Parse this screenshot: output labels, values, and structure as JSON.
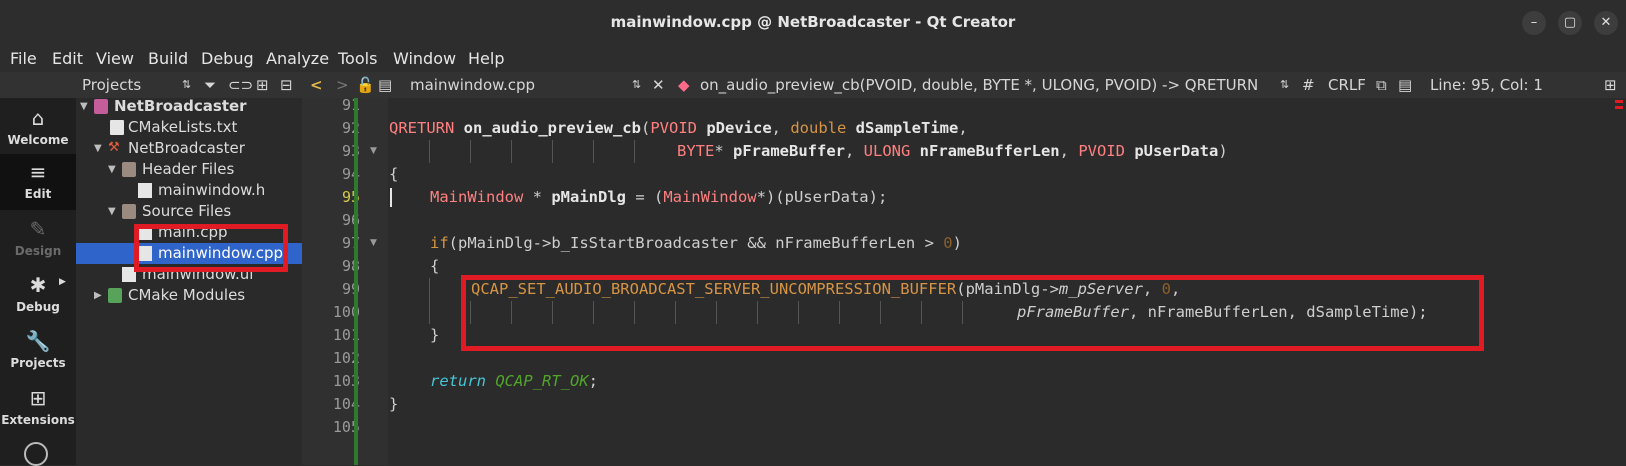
{
  "window": {
    "title": "mainwindow.cpp @ NetBroadcaster - Qt Creator",
    "minimize": "–",
    "maximize": "▢",
    "close": "✕"
  },
  "menu": [
    "File",
    "Edit",
    "View",
    "Build",
    "Debug",
    "Analyze",
    "Tools",
    "Window",
    "Help"
  ],
  "tree_toolbar": {
    "title": "Projects"
  },
  "editor_toolbar": {
    "filename": "mainwindow.cpp",
    "symbol": "on_audio_preview_cb(PVOID, double, BYTE *, ULONG, PVOID) -> QRETURN",
    "hash": "#",
    "encoding": "CRLF",
    "position": "Line: 95, Col: 1"
  },
  "modes": [
    {
      "label": "Welcome",
      "icon": "home-icon"
    },
    {
      "label": "Edit",
      "icon": "edit-icon"
    },
    {
      "label": "Design",
      "icon": "design-icon"
    },
    {
      "label": "Debug",
      "icon": "debug-icon"
    },
    {
      "label": "Projects",
      "icon": "projects-icon"
    },
    {
      "label": "Extensions",
      "icon": "extensions-icon"
    }
  ],
  "tree": [
    {
      "label": "NetBroadcaster",
      "level": 0,
      "expanded": true,
      "bold": true,
      "icon": "project-icon"
    },
    {
      "label": "CMakeLists.txt",
      "level": 1,
      "icon": "cmake-file-icon"
    },
    {
      "label": "NetBroadcaster",
      "level": 1,
      "expanded": true,
      "icon": "hammer-icon"
    },
    {
      "label": "Header Files",
      "level": 2,
      "expanded": true,
      "icon": "folder-icon"
    },
    {
      "label": "mainwindow.h",
      "level": 3,
      "icon": "header-file-icon"
    },
    {
      "label": "Source Files",
      "level": 2,
      "expanded": true,
      "icon": "folder-icon"
    },
    {
      "label": "main.cpp",
      "level": 3,
      "icon": "cpp-file-icon"
    },
    {
      "label": "mainwindow.cpp",
      "level": 3,
      "selected": true,
      "icon": "cpp-file-icon"
    },
    {
      "label": "mainwindow.ui",
      "level": 2,
      "icon": "ui-file-icon"
    },
    {
      "label": "CMake Modules",
      "level": 1,
      "collapsed": true,
      "icon": "cmake-folder-icon"
    }
  ],
  "line_numbers": [
    "91",
    "92",
    "93",
    "94",
    "95",
    "96",
    "97",
    "98",
    "99",
    "100",
    "101",
    "102",
    "103",
    "104",
    "105"
  ],
  "code": {
    "l92": {
      "t1": "QRETURN",
      "t2": "on_audio_preview_cb",
      "t3": "(",
      "t4": "PVOID",
      "t5": " pDevice",
      "t6": ", ",
      "t7": "double",
      "t8": " dSampleTime",
      "t9": ","
    },
    "l93": {
      "t1": "BYTE",
      "t2": "* ",
      "t3": "pFrameBuffer",
      "t4": ", ",
      "t5": "ULONG",
      "t6": " nFrameBufferLen",
      "t7": ", ",
      "t8": "PVOID",
      "t9": " pUserData",
      "t10": ")"
    },
    "l94": "{",
    "l95": {
      "t1": "MainWindow",
      "t2": " * ",
      "t3": "pMainDlg",
      "t4": " = (",
      "t5": "MainWindow",
      "t6": "*)(pUserData);"
    },
    "l97": {
      "t1": "if",
      "t2": "(pMainDlg->b_IsStartBroadcaster && nFrameBufferLen > ",
      "t3": "0",
      "t4": ")"
    },
    "l98": "{",
    "l99": {
      "t1": "QCAP_SET_AUDIO_BROADCAST_SERVER_UNCOMPRESSION_BUFFER",
      "t2": "(pMainDlg->",
      "t3": "m_pServer",
      "t4": ", ",
      "t5": "0",
      "t6": ","
    },
    "l100": {
      "t1": "pFrameBuffer",
      "t2": ", nFrameBufferLen, dSampleTime);"
    },
    "l101": "}",
    "l103": {
      "t1": "return",
      "t2": " ",
      "t3": "QCAP_RT_OK",
      "t4": ";"
    },
    "l104": "}"
  }
}
